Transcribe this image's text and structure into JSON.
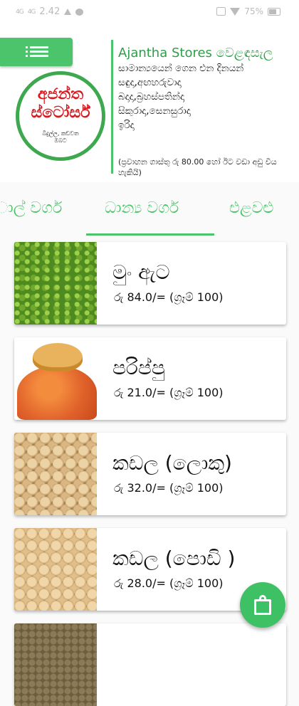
{
  "status_bar": {
    "signal_1": "4G",
    "signal_2": "4G",
    "time": "2.42",
    "battery": "75%"
  },
  "header": {
    "logo": {
      "line1": "අජන්ත",
      "line2": "ස්ටෝර්ස්",
      "sub1": "බිදුල්ල, කඩවත",
      "sub2": "ඔබට"
    },
    "store_name": "Ajantha Stores වෙළඳසැල",
    "lines": [
      "සාමාන්‍යයෙන් ගෙන එන දිනයන්",
      "සඳුදා,අඟහරුවාදා",
      "බදාදා,බ්‍රහස්පතින්දා",
      "සිකුරාදා,සෙනසුරාදා",
      "ඉරිදා"
    ],
    "note": "(ප්‍රවාහන ගාස්තු රු 80.00 හෝ ඊට වඩා අඩු විය හැකියි)"
  },
  "tabs": [
    {
      "label": "ාල් වර්ග",
      "selected": false
    },
    {
      "label": "ධාන්‍ය වර්ග",
      "selected": true
    },
    {
      "label": "එළවළු",
      "selected": false
    }
  ],
  "products": [
    {
      "name": "මුං ඇට",
      "price": "රු 84.0/= (ග්‍රෑම් 100)",
      "image": "mung-beans-image"
    },
    {
      "name": "පරිප්පු",
      "price": "රු 21.0/= (ග්‍රෑම් 100)",
      "image": "red-lentils-image"
    },
    {
      "name": "කඩල (ලොකු)",
      "price": "රු 32.0/= (ග්‍රෑම් 100)",
      "image": "chickpeas-large-image"
    },
    {
      "name": "කඩල (පොඩි )",
      "price": "රු 28.0/= (ග්‍රෑම් 100)",
      "image": "chickpeas-small-image"
    }
  ],
  "colors": {
    "accent": "#4cc46b",
    "logo_red": "#d7191f"
  },
  "icons": {
    "menu": "menu-icon",
    "cart": "shopping-bag-icon"
  }
}
